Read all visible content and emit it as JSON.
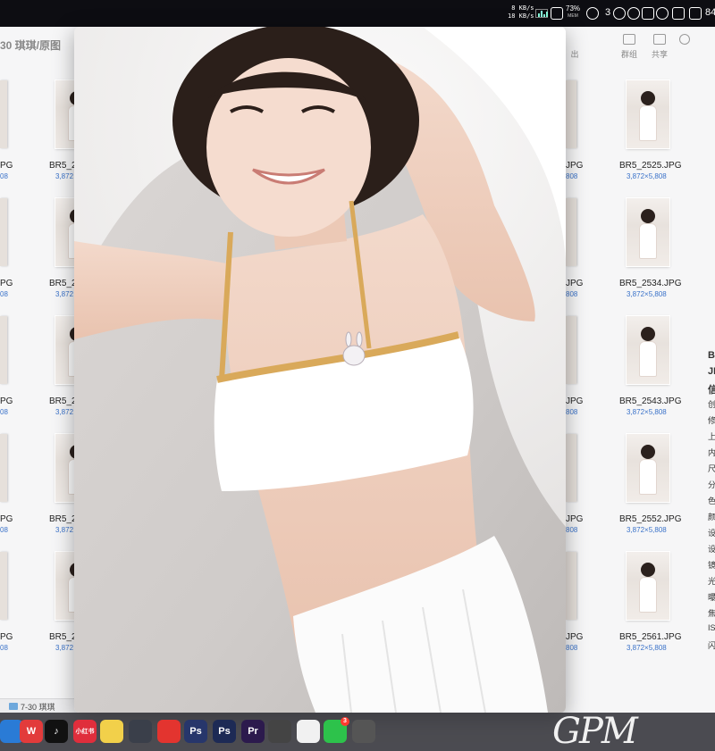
{
  "menubar": {
    "net_up": "8 KB/s",
    "net_down": "18 KB/s",
    "mem_percent": "73%",
    "mem_label": "MEM",
    "notif_count": "3",
    "battery": "84"
  },
  "finder": {
    "title": "30 琪琪/原图",
    "toolbar": {
      "share_label": "共享",
      "group_label": "群组",
      "partial_label": "出"
    },
    "search_label": "Q"
  },
  "files_right": [
    {
      "name": "BR5_2525.JPG",
      "size": "3,872×5,808"
    },
    {
      "name": "BR5_2534.JPG",
      "size": "3,872×5,808"
    },
    {
      "name": "BR5_2543.JPG",
      "size": "3,872×5,808"
    },
    {
      "name": "BR5_2552.JPG",
      "size": "3,872×5,808"
    },
    {
      "name": "BR5_2561.JPG",
      "size": "3,872×5,808"
    }
  ],
  "files_col2": [
    {
      "name": "BR5_2",
      "size": "3,872"
    },
    {
      "name": "BR5_2",
      "size": "3,872"
    },
    {
      "name": "BR5_2",
      "size": "3,872"
    },
    {
      "name": "BR5_2",
      "size": "3,872"
    },
    {
      "name": "BR5_2",
      "size": "3,872"
    }
  ],
  "files_col1": [
    {
      "name": "PG",
      "size": "08"
    },
    {
      "name": "PG",
      "size": "08"
    },
    {
      "name": "PG",
      "size": "08"
    },
    {
      "name": "PG",
      "size": "08"
    },
    {
      "name": "PG",
      "size": "08"
    }
  ],
  "files_col3": [
    {
      "name": "JPG",
      "size": "808"
    },
    {
      "name": "JPG",
      "size": "808"
    },
    {
      "name": "JPG",
      "size": "808"
    },
    {
      "name": "JPG",
      "size": "808"
    },
    {
      "name": "JPG",
      "size": "808"
    }
  ],
  "info_panel": [
    "B",
    "JP",
    "信",
    "创",
    "修",
    "上",
    "内",
    "尺",
    "分",
    "色",
    "颜",
    "设",
    "设",
    "镜",
    "光",
    "曝",
    "焦",
    "IS",
    "闪"
  ],
  "pathbar": {
    "folder": "7-30 琪琪"
  },
  "dock": {
    "apps": [
      {
        "name": "wechat-work",
        "label": "",
        "color": "#2a7bd6"
      },
      {
        "name": "wps",
        "label": "W",
        "color": "#e23b3b"
      },
      {
        "name": "tiktok",
        "label": "♪",
        "color": "#111111"
      },
      {
        "name": "xiaohongshu",
        "label": "小红书",
        "color": "#e02e3c"
      },
      {
        "name": "notes",
        "label": "",
        "color": "#f2d04a"
      },
      {
        "name": "davinci",
        "label": "",
        "color": "#3a3f4a"
      },
      {
        "name": "netease-music",
        "label": "",
        "color": "#e3342f"
      },
      {
        "name": "photoshop-1",
        "label": "Ps",
        "color": "#27366b"
      },
      {
        "name": "photoshop-2",
        "label": "Ps",
        "color": "#1d2a55"
      },
      {
        "name": "premiere",
        "label": "Pr",
        "color": "#2c1a4d"
      },
      {
        "name": "final-cut",
        "label": "",
        "color": "#444444"
      },
      {
        "name": "qq",
        "label": "",
        "color": "#f1f1f1"
      },
      {
        "name": "wechat",
        "label": "",
        "color": "#2dc24b"
      },
      {
        "name": "camera",
        "label": "",
        "color": "#555555"
      }
    ],
    "wechat_badge": "3",
    "watermark": "GPM"
  }
}
